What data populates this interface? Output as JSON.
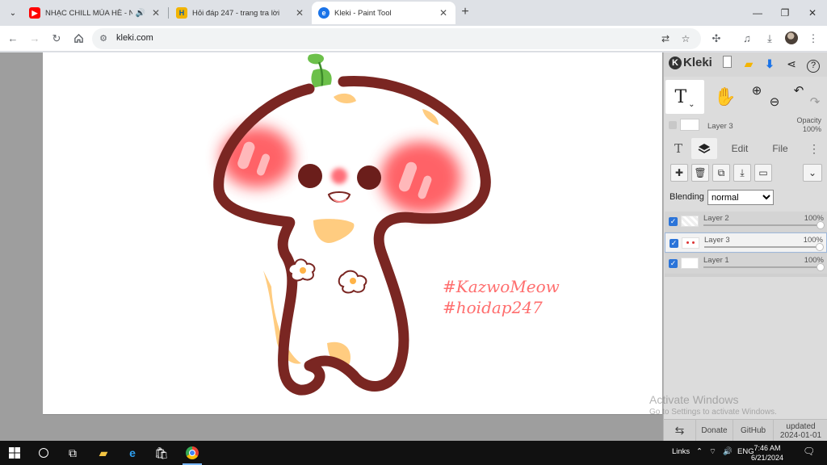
{
  "browser": {
    "tabs": [
      {
        "title": "NHẠC CHILL MÙA HÈ - Nấ",
        "extra": "🔊"
      },
      {
        "title": "Hỏi đáp 247 - trang tra lời"
      },
      {
        "title": "Kleki - Paint Tool"
      }
    ],
    "url": "kleki.com"
  },
  "kleki": {
    "logo": "Kleki",
    "tool_selected": "T",
    "layer_info": {
      "name": "Layer 3",
      "opacity_label": "Opacity",
      "opacity_value": "100%"
    },
    "tabs": {
      "edit": "Edit",
      "file": "File"
    },
    "blending": {
      "label": "Blending",
      "value": "normal"
    },
    "layers": [
      {
        "name": "Layer 2",
        "opacity": "100%"
      },
      {
        "name": "Layer 3",
        "opacity": "100%"
      },
      {
        "name": "Layer 1",
        "opacity": "100%"
      }
    ],
    "footer": {
      "donate": "Donate",
      "github": "GitHub",
      "updated_label": "updated",
      "updated_date": "2024-01-01"
    }
  },
  "canvas": {
    "text_line1": "#KazwoMeow",
    "text_line2": "#hoidap247"
  },
  "windows": {
    "activate_title": "Activate Windows",
    "activate_sub": "Go to Settings to activate Windows."
  },
  "taskbar": {
    "links": "Links",
    "lang": "ENG",
    "time": "7:46 AM",
    "date": "6/21/2024"
  },
  "colors": {
    "accent_blue": "#2b74d9",
    "mushroom_outline": "#7a2622",
    "cheek_red": "#ff5a5f",
    "spot_orange": "#ffcc80",
    "hashtag_pink": "#ff6e6e"
  }
}
